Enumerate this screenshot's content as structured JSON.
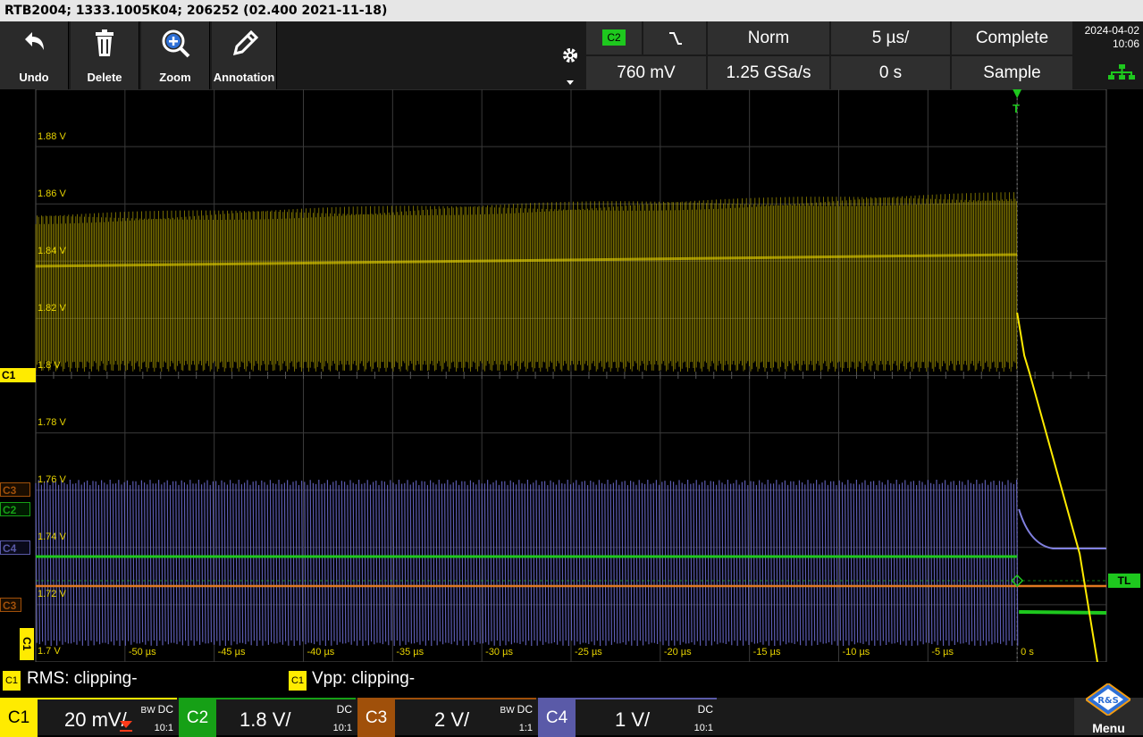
{
  "titlebar": {
    "text": "RTB2004; 1333.1005K04; 206252 (02.400 2021-11-18)"
  },
  "toolbar": {
    "buttons": [
      {
        "label": "Undo",
        "icon": "undo-icon"
      },
      {
        "label": "Delete",
        "icon": "trash-icon"
      },
      {
        "label": "Zoom",
        "icon": "zoom-icon"
      },
      {
        "label": "Annotation",
        "icon": "pencil-icon"
      }
    ]
  },
  "status": {
    "trigger_source": "C2",
    "trigger_slope": "falling-edge",
    "trigger_mode": "Norm",
    "timebase": "5 µs/",
    "acq_state": "Complete",
    "trigger_level": "760 mV",
    "sample_rate": "1.25 GSa/s",
    "h_position": "0 s",
    "acq_mode": "Sample",
    "date": "2024-04-02",
    "time": "10:06"
  },
  "plot": {
    "y_labels": [
      "1.88 V",
      "1.86 V",
      "1.84 V",
      "1.82 V",
      "1.8 V",
      "1.78 V",
      "1.76 V",
      "1.74 V",
      "1.72 V",
      "1.7 V"
    ],
    "x_labels": [
      "-50 µs",
      "-45 µs",
      "-40 µs",
      "-35 µs",
      "-30 µs",
      "-25 µs",
      "-20 µs",
      "-15 µs",
      "-10 µs",
      "-5 µs",
      "0 s"
    ],
    "markers": {
      "c1": "C1",
      "c3": "C3",
      "c2": "C2",
      "c4": "C4",
      "c3b": "C3",
      "c1b": "C1",
      "tl": "TL",
      "t": "T"
    }
  },
  "measurements": [
    {
      "chip": "C1",
      "text": "RMS: clipping-"
    },
    {
      "chip": "C1",
      "text": "Vpp: clipping-"
    }
  ],
  "channels": [
    {
      "name": "C1",
      "scale": "20 mV/",
      "coupling": "DC",
      "bw": "BW",
      "probe": "10:1",
      "color": "#ffeb00"
    },
    {
      "name": "C2",
      "scale": "1.8 V/",
      "coupling": "DC",
      "bw": "",
      "probe": "10:1",
      "color": "#16a016"
    },
    {
      "name": "C3",
      "scale": "2 V/",
      "coupling": "DC",
      "bw": "BW",
      "probe": "1:1",
      "color": "#a0500a"
    },
    {
      "name": "C4",
      "scale": "1 V/",
      "coupling": "DC",
      "bw": "",
      "probe": "10:1",
      "color": "#5a5aa8"
    }
  ],
  "menu": {
    "label": "Menu"
  }
}
